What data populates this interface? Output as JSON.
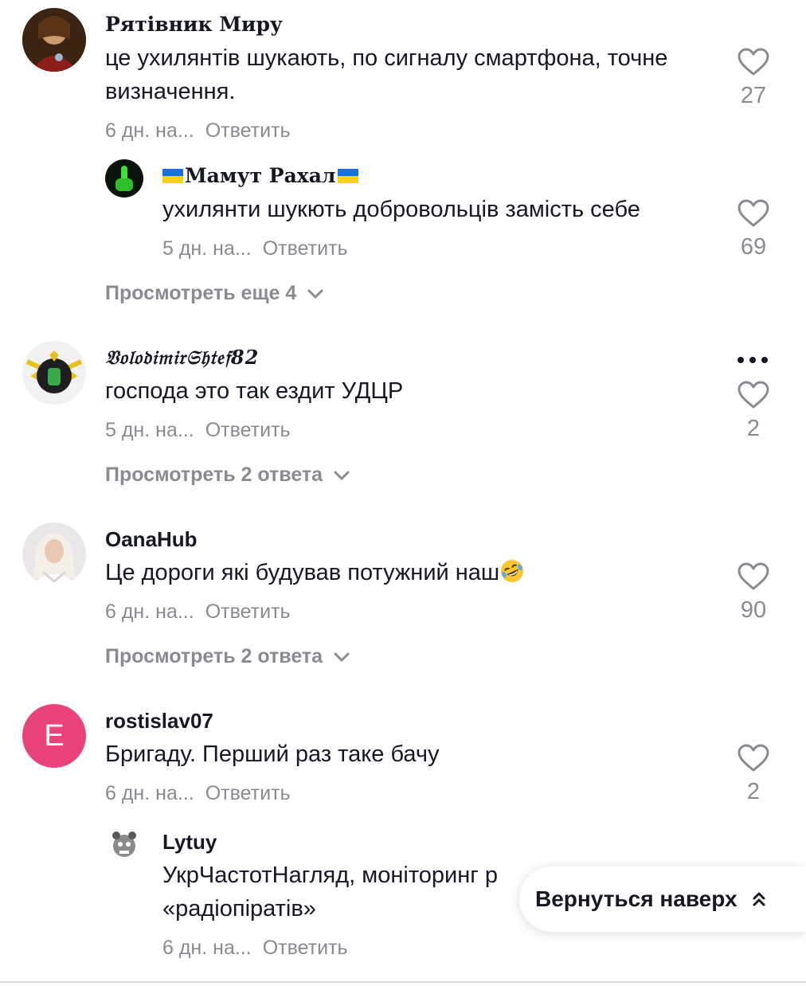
{
  "comments": [
    {
      "username": "Рятівник Миру",
      "text": "це ухилянтів шукають, по сигналу смартфона, точне визначення.",
      "time": "6 дн. на...",
      "reply": "Ответить",
      "likes": "27",
      "replies_preview": [
        {
          "username": "Мамут Рахал",
          "text": "ухилянти шукють добровольців замість себе",
          "time": "5 дн. на...",
          "reply": "Ответить",
          "likes": "69"
        }
      ],
      "view_more": "Просмотреть еще 4"
    },
    {
      "username": "𝔙𝔬𝔩𝔬𝔡𝔦𝔪𝔦𝔯𝔖𝔥𝔱𝔢𝔣82",
      "text": "господа это так ездит УДЦР",
      "time": "5 дн. на...",
      "reply": "Ответить",
      "likes": "2",
      "view_more": "Просмотреть 2 ответа"
    },
    {
      "username": "OanaHub",
      "text": "Це дороги які будував потужний наш",
      "emoji": "🤣",
      "time": "6 дн. на...",
      "reply": "Ответить",
      "likes": "90",
      "view_more": "Просмотреть 2 ответа"
    },
    {
      "username": "rostislav07",
      "avatar_letter": "E",
      "text": "Бригаду. Перший раз таке бачу",
      "time": "6 дн. на...",
      "reply": "Ответить",
      "likes": "2",
      "replies_preview": [
        {
          "username": "Lytuy",
          "text_line1": "УкрЧастотНагляд, моніторинг р",
          "text_line2": "«радіопіратів»",
          "time": "6 дн. на...",
          "reply": "Ответить"
        }
      ]
    }
  ],
  "back_to_top": "Вернуться наверх",
  "colors": {
    "text": "#161823",
    "muted": "#8a8b91",
    "avatar_pink": "#e8437a"
  },
  "icons": [
    "heart-icon",
    "chevron-down-icon",
    "more-icon",
    "double-chevron-up-icon",
    "ukraine-flag-icon",
    "rofl-emoji-icon"
  ]
}
